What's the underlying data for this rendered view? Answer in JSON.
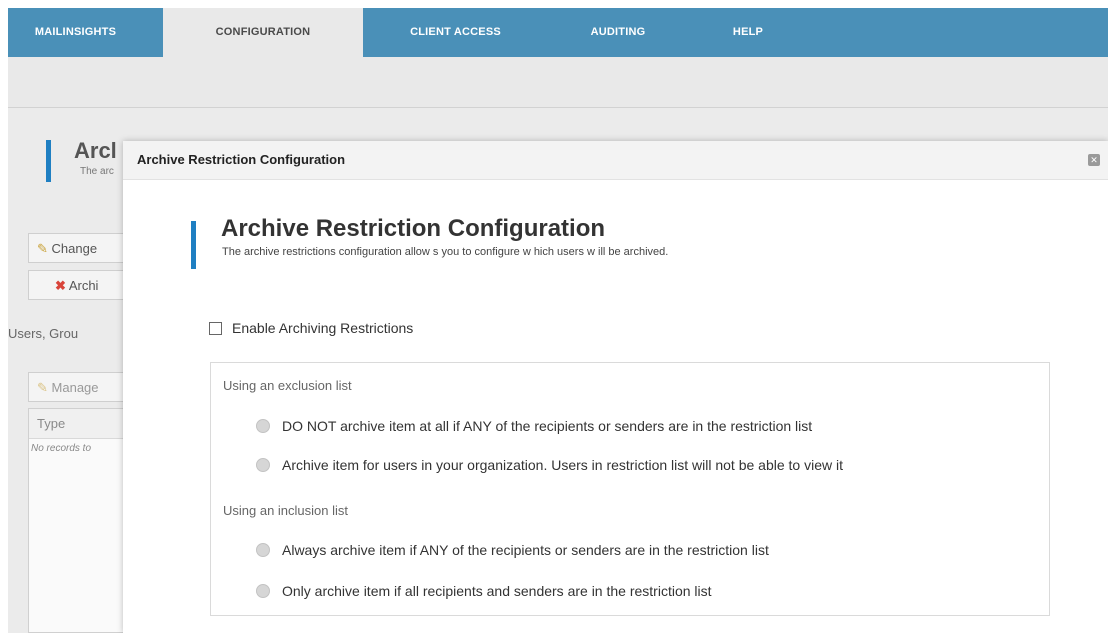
{
  "nav": {
    "tabs": [
      {
        "label": "MAILINSIGHTS"
      },
      {
        "label": "CONFIGURATION"
      },
      {
        "label": "CLIENT ACCESS"
      },
      {
        "label": "AUDITING"
      },
      {
        "label": "HELP"
      }
    ]
  },
  "background_page": {
    "title": "Arcl",
    "subtitle": "The arc",
    "change_button": "Change",
    "archive_button": "Archi",
    "users_groups_label": "Users, Grou",
    "manage_button": "Manage",
    "grid_header": "Type",
    "grid_empty": "No records to"
  },
  "modal": {
    "header_title": "Archive Restriction Configuration",
    "close_glyph": "✕",
    "title": "Archive Restriction Configuration",
    "subtitle": "The archive restrictions configuration allow s you to configure w hich users w ill be archived.",
    "enable_label": "Enable Archiving Restrictions",
    "enable_checked": false,
    "exclusion": {
      "label": "Using an exclusion list",
      "options": [
        "DO NOT archive item at all if ANY of the recipients or senders are in the restriction list",
        "Archive item for users in your organization. Users in restriction list will not be able to view it"
      ]
    },
    "inclusion": {
      "label": "Using an inclusion list",
      "options": [
        "Always archive item if ANY of the recipients or senders are in the restriction list",
        "Only archive item if all recipients and senders are in the restriction list"
      ]
    }
  },
  "colors": {
    "nav_bg": "#4a90b8",
    "accent_bar": "#1f7fc2"
  }
}
